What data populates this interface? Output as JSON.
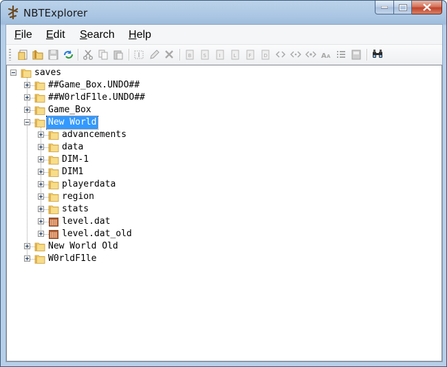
{
  "window": {
    "title": "NBTExplorer"
  },
  "menu": [
    {
      "accel": "F",
      "rest": "ile"
    },
    {
      "accel": "E",
      "rest": "dit"
    },
    {
      "accel": "S",
      "rest": "earch"
    },
    {
      "accel": "H",
      "rest": "elp"
    }
  ],
  "toolbar": {
    "buttons": [
      "open-file-icon",
      "open-folder-icon",
      "save-icon",
      "refresh-icon",
      "cut-icon",
      "copy-icon",
      "paste-icon",
      "rename-icon",
      "edit-icon",
      "delete-icon",
      "add-byte-icon",
      "add-short-icon",
      "add-int-icon",
      "add-long-icon",
      "add-float-icon",
      "add-double-icon",
      "add-byte-array-icon",
      "add-int-array-icon",
      "add-long-array-icon",
      "add-string-icon",
      "add-list-icon",
      "add-compound-icon",
      "find-icon"
    ]
  },
  "tree": {
    "nodes": [
      {
        "label": "saves",
        "type": "folder",
        "depth": 0,
        "state": "expanded"
      },
      {
        "label": "##Game_Box.UNDO##",
        "type": "folder",
        "depth": 1,
        "state": "collapsed"
      },
      {
        "label": "##W0rldF1le.UNDO##",
        "type": "folder",
        "depth": 1,
        "state": "collapsed"
      },
      {
        "label": "Game_Box",
        "type": "folder",
        "depth": 1,
        "state": "collapsed"
      },
      {
        "label": "New World",
        "type": "folder",
        "depth": 1,
        "state": "expanded",
        "selected": true
      },
      {
        "label": "advancements",
        "type": "folder",
        "depth": 2,
        "state": "collapsed"
      },
      {
        "label": "data",
        "type": "folder",
        "depth": 2,
        "state": "collapsed"
      },
      {
        "label": "DIM-1",
        "type": "folder",
        "depth": 2,
        "state": "collapsed"
      },
      {
        "label": "DIM1",
        "type": "folder",
        "depth": 2,
        "state": "collapsed"
      },
      {
        "label": "playerdata",
        "type": "folder",
        "depth": 2,
        "state": "collapsed"
      },
      {
        "label": "region",
        "type": "folder",
        "depth": 2,
        "state": "collapsed"
      },
      {
        "label": "stats",
        "type": "folder",
        "depth": 2,
        "state": "collapsed"
      },
      {
        "label": "level.dat",
        "type": "nbt-file",
        "depth": 2,
        "state": "collapsed"
      },
      {
        "label": "level.dat_old",
        "type": "nbt-file",
        "depth": 2,
        "state": "collapsed"
      },
      {
        "label": "New World Old",
        "type": "folder",
        "depth": 1,
        "state": "collapsed"
      },
      {
        "label": "W0rldF1le",
        "type": "folder",
        "depth": 1,
        "state": "collapsed"
      }
    ]
  },
  "colors": {
    "selection": "#3399ff",
    "folder": "#f2cf6a",
    "nbt_file": "#c9764a"
  }
}
